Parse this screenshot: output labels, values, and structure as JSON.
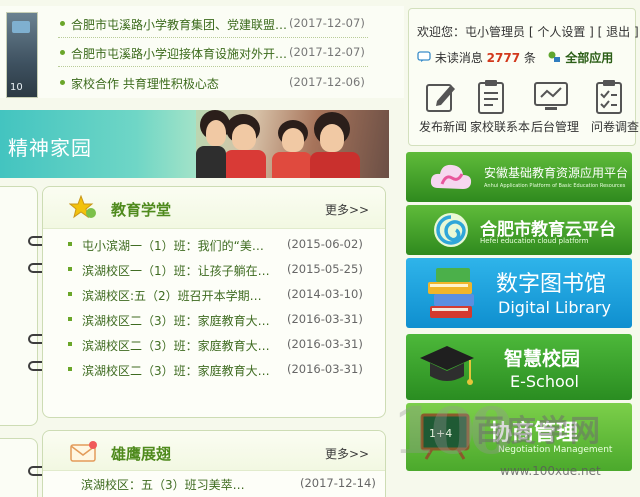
{
  "top_news": [
    {
      "title": "合肥市屯溪路小学教育集团、党建联盟…",
      "date": "(2017-12-07)"
    },
    {
      "title": "合肥市屯溪路小学迎接体育设施对外开…",
      "date": "(2017-12-07)"
    },
    {
      "title": "家校合作  共育理性积极心态",
      "date": "(2017-12-06)"
    }
  ],
  "thumb_number": "10",
  "banner_text": "精神家园",
  "education": {
    "title": "教育学堂",
    "more": "更多>>",
    "items": [
      {
        "title": "屯小滨湖一（1）班：我们的“美…",
        "date": "(2015-06-02)"
      },
      {
        "title": "滨湖校区一（1）班：让孩子躺在…",
        "date": "(2015-05-25)"
      },
      {
        "title": "滨湖校区:五（2）班召开本学期…",
        "date": "(2014-03-10)"
      },
      {
        "title": "滨湖校区二（3）班：家庭教育大…",
        "date": "(2016-03-31)"
      },
      {
        "title": "滨湖校区二（3）班：家庭教育大…",
        "date": "(2016-03-31)"
      },
      {
        "title": "滨湖校区二（3）班：家庭教育大…",
        "date": "(2016-03-31)"
      }
    ]
  },
  "eagle": {
    "title": "雄鹰展翅",
    "more": "更多>>",
    "partial_item": {
      "title": "滨湖校区：五（3）班习美萃…",
      "date": "(2017-12-14)"
    }
  },
  "user": {
    "welcome": "欢迎您：屯小管理员",
    "settings": "[ 个人设置 ]",
    "logout": "[ 退出 ]",
    "unread_label": "未读消息",
    "unread_count": "2777",
    "unread_unit": "条",
    "all_apps": "全部应用",
    "quick_links": [
      "发布新闻",
      "家校联系本",
      "后台管理",
      "问卷调查"
    ]
  },
  "side_banners": {
    "anhui_title": "安徽基础教育资源应用平台",
    "anhui_sub": "Anhui Application Platform of Basic Education Resources",
    "hefei_title": "合肥市教育云平台",
    "hefei_sub": "Hefei education cloud platform",
    "library_title": "数字图书馆",
    "library_sub": "Digital Library",
    "school_title": "智慧校园",
    "school_sub": "E-School",
    "nego_title": "协商管理",
    "nego_sub": "Negotiation Management"
  },
  "watermark": {
    "num": "100",
    "cn": "百度学网",
    "url": "www.100xue.net"
  },
  "colors": {
    "accent_green": "#4f8a1d",
    "count_red": "#d2381c",
    "library_blue": "#1aa3df"
  }
}
